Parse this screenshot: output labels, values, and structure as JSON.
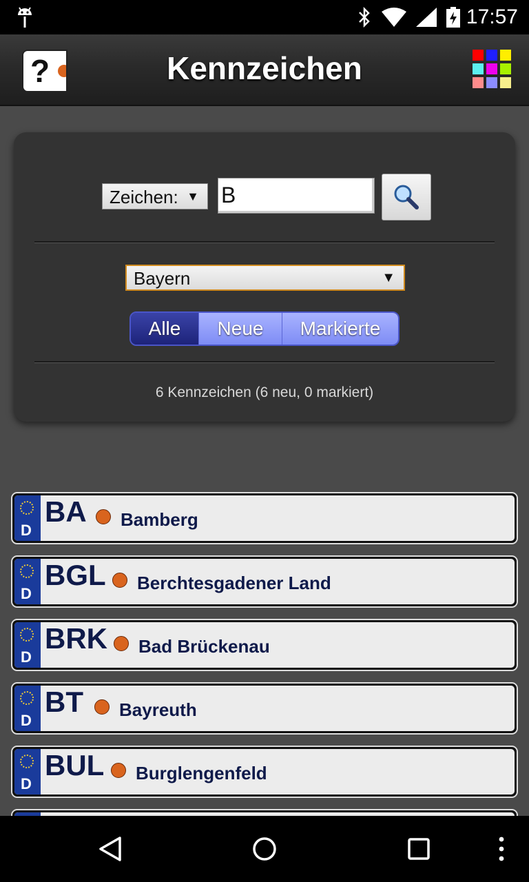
{
  "status_bar": {
    "time": "17:57"
  },
  "header": {
    "title": "Kennzeichen",
    "help_glyph": "?"
  },
  "search": {
    "mode_label": "Zeichen:",
    "mode_arrow": "▼",
    "query": "B",
    "state": "Bayern",
    "state_arrow": "▼",
    "filters": [
      "Alle",
      "Neue",
      "Markierte"
    ],
    "active_filter": "Alle",
    "summary": "6 Kennzeichen (6 neu, 0 markiert)"
  },
  "plates": [
    {
      "code": "BA",
      "name": "Bamberg",
      "country": "D"
    },
    {
      "code": "BGL",
      "name": "Berchtesgadener Land",
      "country": "D"
    },
    {
      "code": "BRK",
      "name": "Bad Brückenau",
      "country": "D"
    },
    {
      "code": "BT",
      "name": "Bayreuth",
      "country": "D"
    },
    {
      "code": "BUL",
      "name": "Burglengenfeld",
      "country": "D"
    }
  ],
  "colors": {
    "accent": "#7e8cf5",
    "active_segment": "#1d237a",
    "plate_text": "#0f1a4a",
    "eu_band": "#1a3b9b",
    "seal": "#d9641e"
  },
  "icons": [
    "android-debug-icon",
    "bluetooth-icon",
    "wifi-icon",
    "cell-signal-icon",
    "battery-charging-icon",
    "help-icon",
    "color-grid-icon",
    "magnifier-icon",
    "back-icon",
    "home-icon",
    "recents-icon",
    "overflow-menu-icon"
  ]
}
